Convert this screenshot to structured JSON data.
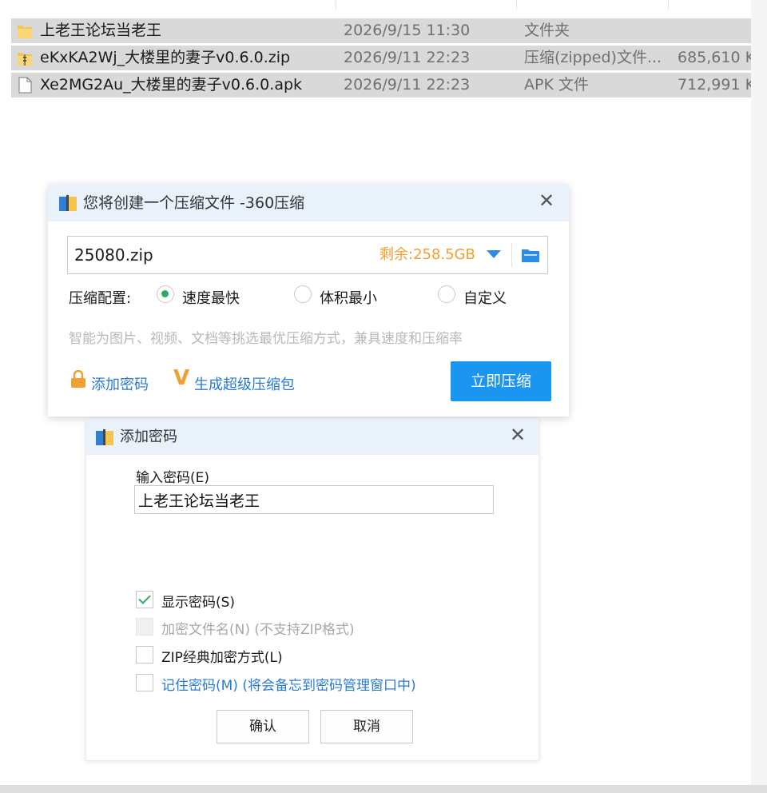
{
  "file_list": {
    "rows": [
      {
        "name": "上老王论坛当老王",
        "date": "2026/9/15 11:30",
        "type": "文件夹",
        "size": "",
        "icon": "folder-icon"
      },
      {
        "name": "eKxKA2Wj_大楼里的妻子v0.6.0.zip",
        "date": "2026/9/11 22:23",
        "type": "压缩(zipped)文件...",
        "size": "685,610 K",
        "icon": "zip-folder-icon"
      },
      {
        "name": "Xe2MG2Au_大楼里的妻子v0.6.0.apk",
        "date": "2026/9/11 22:23",
        "type": "APK 文件",
        "size": "712,991 K",
        "icon": "file-icon"
      }
    ]
  },
  "compress_dialog": {
    "title": "您将创建一个压缩文件 -360压缩",
    "filename": "25080.zip",
    "free_space": "剩余:258.5GB",
    "config_label": "压缩配置:",
    "options": [
      {
        "label": "速度最快",
        "selected": true
      },
      {
        "label": "体积最小",
        "selected": false
      },
      {
        "label": "自定义",
        "selected": false
      }
    ],
    "hint": "智能为图片、视频、文档等挑选最优压缩方式，兼具速度和压缩率",
    "add_password": "添加密码",
    "super_pack": "生成超级压缩包",
    "compress_button": "立即压缩"
  },
  "password_dialog": {
    "title": "添加密码",
    "input_label": "输入密码(E)",
    "password_value": "上老王论坛当老王",
    "checkboxes": [
      {
        "label": "显示密码(S)",
        "checked": true,
        "disabled": false
      },
      {
        "label": "加密文件名(N) (不支持ZIP格式)",
        "checked": false,
        "disabled": true
      },
      {
        "label": "ZIP经典加密方式(L)",
        "checked": false,
        "disabled": false
      },
      {
        "label": "记住密码(M) (将会备忘到密码管理窗口中)",
        "checked": false,
        "disabled": false
      }
    ],
    "ok_button": "确认",
    "cancel_button": "取消"
  },
  "colors": {
    "titlebar": "#e9f1fb",
    "primary_button": "#1a95f0",
    "link": "#2a7bd0",
    "accent_orange": "#f0a030",
    "check_green": "#2bab63",
    "selected_row": "#d9d9d9"
  }
}
